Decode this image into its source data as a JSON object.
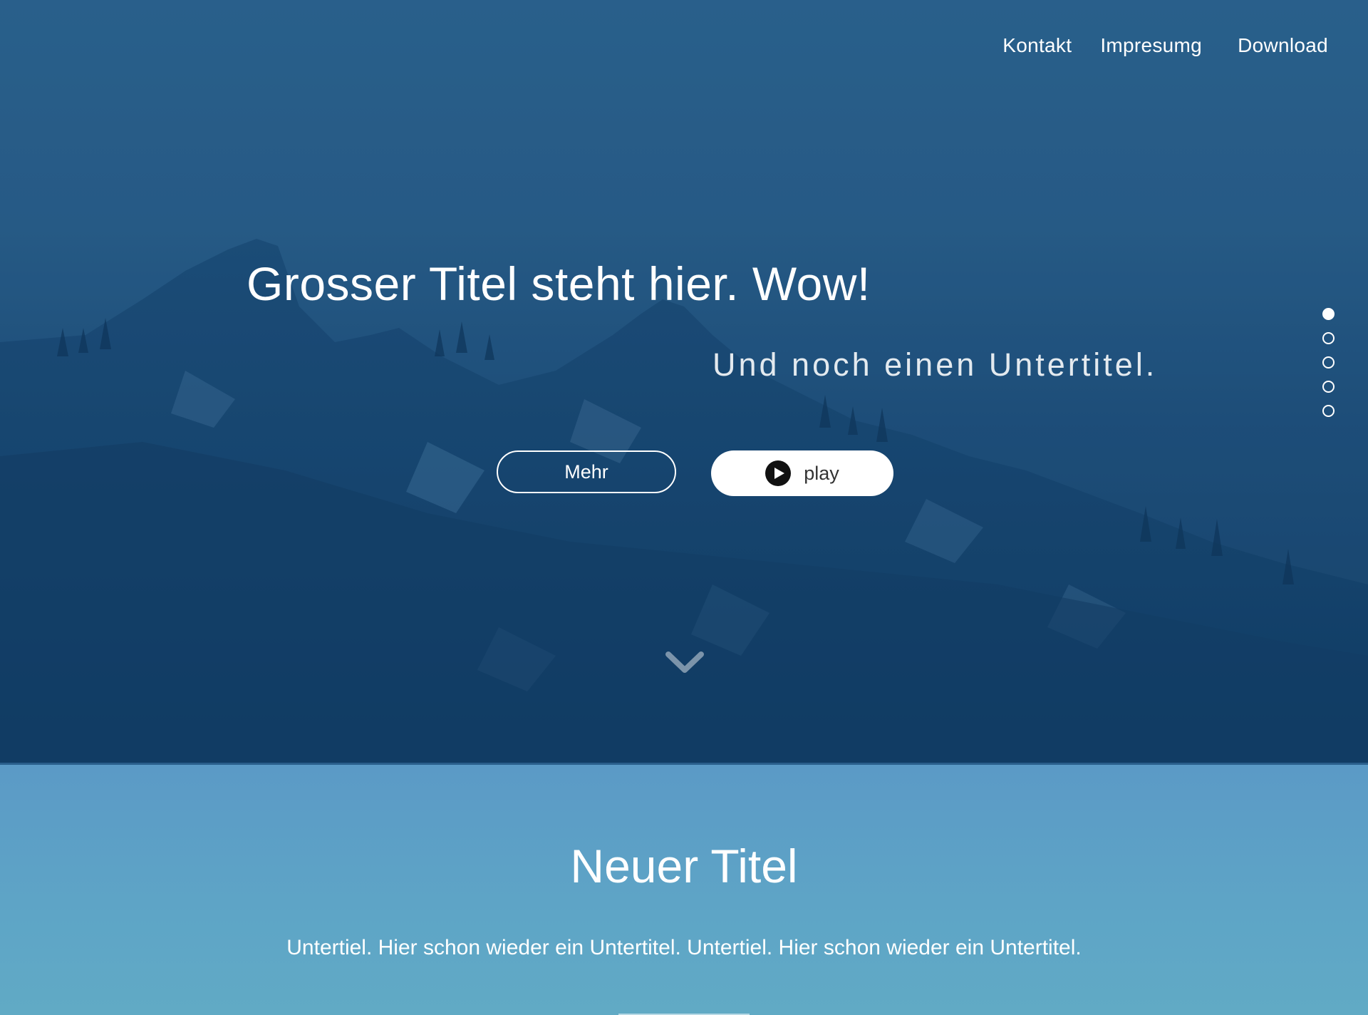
{
  "nav": {
    "items": [
      {
        "label": "Kontakt"
      },
      {
        "label": "Impresumg"
      },
      {
        "label": "Download"
      }
    ]
  },
  "hero": {
    "title": "Grosser Titel steht hier. Wow!",
    "subtitle": "Und noch einen Untertitel.",
    "more_button": "Mehr",
    "play_button": "play",
    "slide_count": 5,
    "active_slide": 1
  },
  "section2": {
    "title": "Neuer Titel",
    "text": "Untertiel. Hier schon wieder ein Untertitel. Untertiel. Hier schon wieder ein Untertitel."
  },
  "colors": {
    "hero_overlay": "#1f4f7a",
    "section_bg": "#5ea5c6",
    "text": "#ffffff"
  }
}
